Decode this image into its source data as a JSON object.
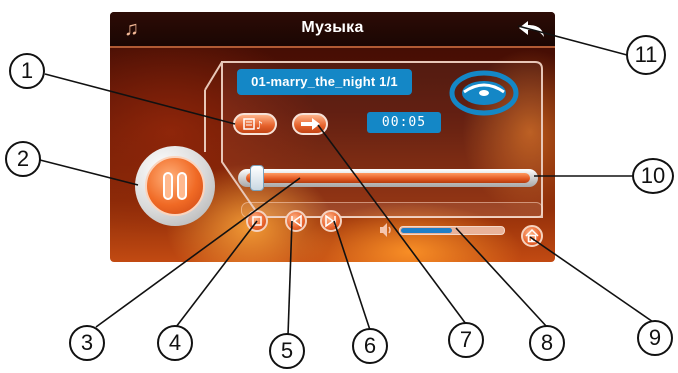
{
  "screen": {
    "title": "Музыка",
    "track_display": "01-marry_the_night   1/1",
    "time_display": "00:05",
    "playback_progress": 0.0,
    "volume_level": 0.5
  },
  "icons": {
    "title_left": "music-note-icon",
    "title_right": "back-arrow-icon",
    "disc": "disc-icon",
    "playlist": "playlist-icon",
    "repeat": "repeat-arrow-icon",
    "play_pause": "pause-icon",
    "stop": "stop-icon",
    "prev": "previous-track-icon",
    "next": "next-track-icon",
    "volume": "speaker-icon",
    "home": "home-icon"
  },
  "callouts": [
    "1",
    "2",
    "3",
    "4",
    "5",
    "6",
    "7",
    "8",
    "9",
    "10",
    "11"
  ],
  "colors": {
    "accent_orange": "#e5612b",
    "display_blue": "#1487c6",
    "volume_blue": "#1f7fc7"
  }
}
